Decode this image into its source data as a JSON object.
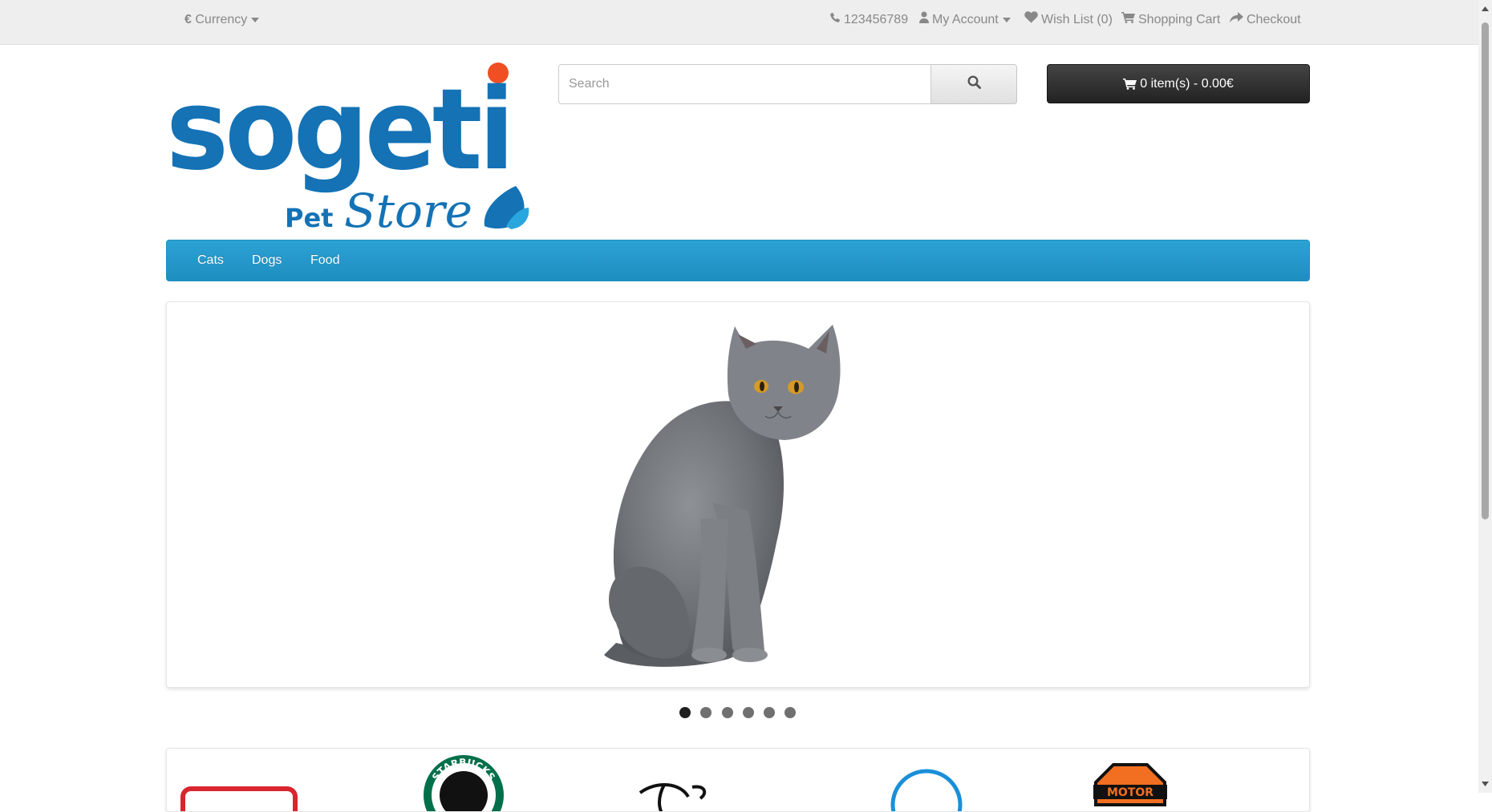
{
  "topbar": {
    "currency_symbol": "€",
    "currency_label": "Currency",
    "phone": "123456789",
    "my_account": "My Account",
    "wish_list": "Wish List (0)",
    "shopping_cart": "Shopping Cart",
    "checkout": "Checkout"
  },
  "logo": {
    "brand": "sogeti",
    "sub1": "Pet",
    "sub2": "Store"
  },
  "search": {
    "placeholder": "Search"
  },
  "cart": {
    "label": "0 item(s) - 0.00€"
  },
  "menu": {
    "items": [
      "Cats",
      "Dogs",
      "Food"
    ]
  },
  "slideshow": {
    "slide_count": 6,
    "active_slide": 1
  },
  "brands": {
    "starbucks_text": "STARBUCKS",
    "harley_text": "MOTOR"
  },
  "colors": {
    "brand_blue": "#1472b5",
    "menu_blue": "#229ac8",
    "logo_dot": "#f04e23",
    "cart_dark": "#303030"
  }
}
